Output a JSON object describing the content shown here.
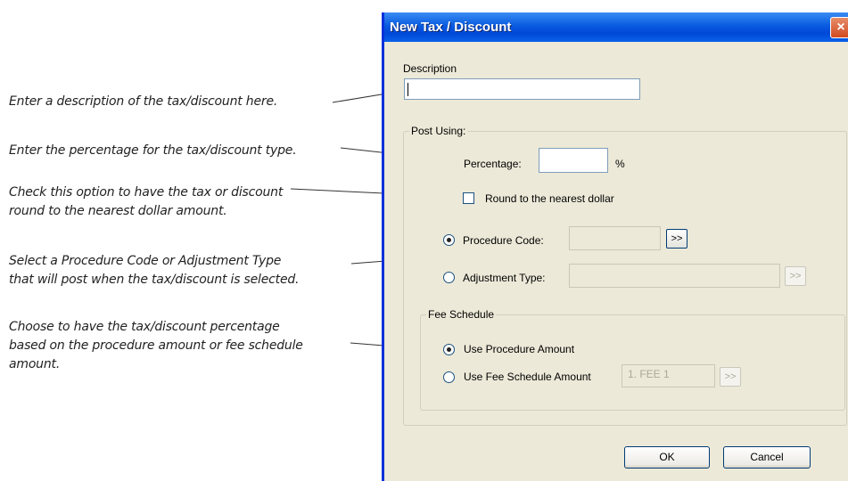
{
  "annotations": {
    "description": "Enter a description of the tax/discount here.",
    "percentage": "Enter the percentage for the tax/discount type.",
    "round_line1": "Check this option to have the tax or discount",
    "round_line2": "round to the nearest dollar amount.",
    "code_line1": "Select a Procedure Code or Adjustment Type",
    "code_line2": "that will post when the tax/discount is selected.",
    "fee_line1": "Choose to have the tax/discount percentage",
    "fee_line2": "based on the procedure amount or fee schedule",
    "fee_line3": "amount."
  },
  "dialog": {
    "title": "New Tax / Discount",
    "close_icon": "×",
    "description_label": "Description",
    "description_value": "",
    "post_using": {
      "legend": "Post Using:",
      "percentage_label": "Percentage:",
      "percentage_value": "",
      "percent_sign": "%",
      "round_label": "Round to the nearest dollar",
      "round_checked": false,
      "procedure_code_label": "Procedure Code:",
      "procedure_code_selected": true,
      "procedure_code_value": "",
      "adjustment_type_label": "Adjustment Type:",
      "adjustment_type_value": "",
      "browse_label": ">>"
    },
    "fee_schedule": {
      "legend": "Fee Schedule",
      "use_procedure_label": "Use Procedure Amount",
      "use_procedure_selected": true,
      "use_fee_label": "Use Fee Schedule Amount",
      "fee_value": "1. FEE 1",
      "browse_label": ">>"
    },
    "ok_label": "OK",
    "cancel_label": "Cancel"
  }
}
